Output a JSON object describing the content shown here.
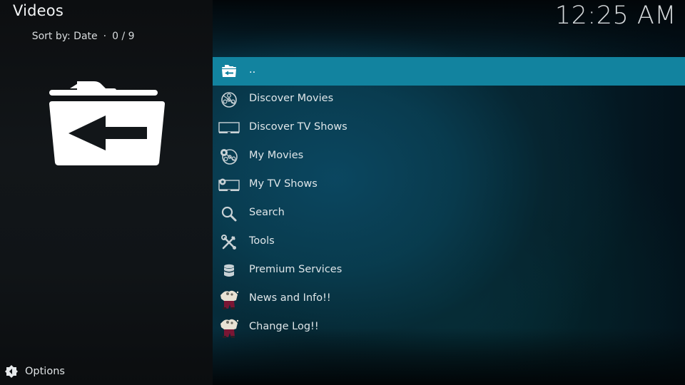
{
  "header": {
    "title": "Videos",
    "sort_label": "Sort by: Date",
    "separator": "·",
    "position": "0 / 9"
  },
  "clock": {
    "time": "12:25 AM"
  },
  "preview": {
    "icon": "folder-back-icon"
  },
  "list": {
    "items": [
      {
        "label": "..",
        "icon": "folder-back-icon",
        "selected": true
      },
      {
        "label": "Discover Movies",
        "icon": "film-reel-icon",
        "selected": false
      },
      {
        "label": "Discover TV Shows",
        "icon": "tv-icon",
        "selected": false
      },
      {
        "label": "My Movies",
        "icon": "film-reel-gear-icon",
        "selected": false
      },
      {
        "label": "My TV Shows",
        "icon": "tv-gear-icon",
        "selected": false
      },
      {
        "label": "Search",
        "icon": "search-icon",
        "selected": false
      },
      {
        "label": "Tools",
        "icon": "tools-icon",
        "selected": false
      },
      {
        "label": "Premium Services",
        "icon": "database-icon",
        "selected": false
      },
      {
        "label": "News and Info!!",
        "icon": "character-thumbnail-icon",
        "selected": false
      },
      {
        "label": "Change Log!!",
        "icon": "character-thumbnail-icon",
        "selected": false
      }
    ]
  },
  "footer": {
    "options_label": "Options",
    "options_icon": "options-icon"
  },
  "colors": {
    "selected_row": "#12839f",
    "left_panel": "#121619",
    "background_accent": "#093a52",
    "text": "#dfe6e9"
  }
}
